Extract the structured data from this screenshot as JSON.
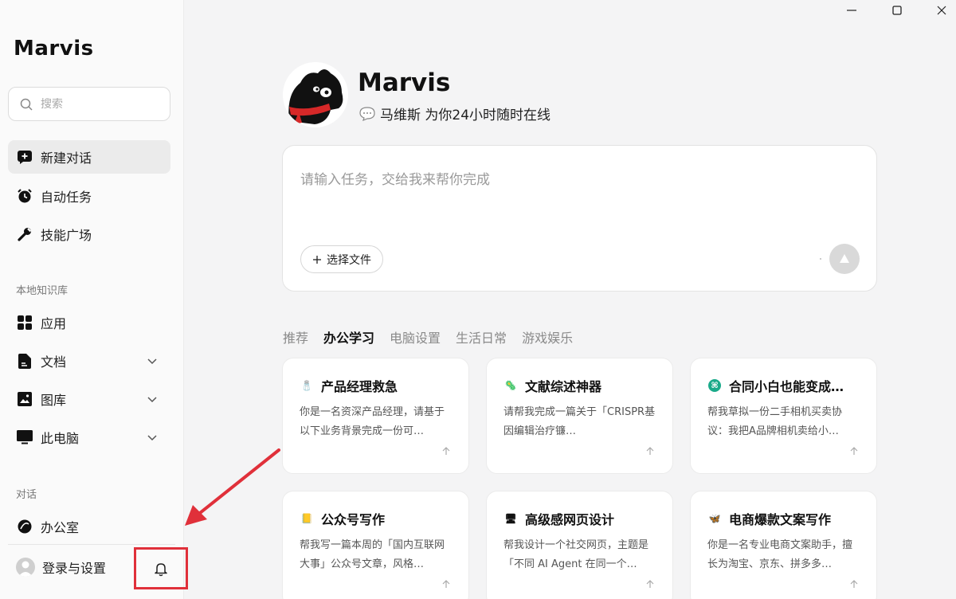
{
  "app": {
    "brand": "Marvis"
  },
  "colors": {
    "accent_red": "#e0303a",
    "background": "#f4f4f5"
  },
  "sidebar": {
    "search_placeholder": "搜索",
    "nav": [
      {
        "label": "新建对话",
        "icon": "new-chat-icon",
        "active": true
      },
      {
        "label": "自动任务",
        "icon": "alarm-clock-icon"
      },
      {
        "label": "技能广场",
        "icon": "wrench-icon"
      }
    ],
    "knowledge_label": "本地知识库",
    "knowledge": [
      {
        "label": "应用",
        "icon": "apps-grid-icon"
      },
      {
        "label": "文档",
        "icon": "document-icon"
      },
      {
        "label": "图库",
        "icon": "image-icon"
      },
      {
        "label": "此电脑",
        "icon": "monitor-icon"
      }
    ],
    "chat_label": "对话",
    "chats": [
      {
        "label": "办公室",
        "icon": "office-icon"
      }
    ],
    "login_label": "登录与设置"
  },
  "main": {
    "agent_name": "Marvis",
    "agent_tagline": "马维斯 为你24小时随时在线",
    "composer_placeholder": "请输入任务，交给我来帮你完成",
    "file_button": "选择文件",
    "tabs": [
      "推荐",
      "办公学习",
      "电脑设置",
      "生活日常",
      "游戏娱乐"
    ],
    "active_tab": "办公学习",
    "cards": [
      {
        "title": "产品经理救急",
        "emoji": "🧂",
        "desc": "你是一名资深产品经理，请基于以下业务背景完成一份可…"
      },
      {
        "title": "文献综述神器",
        "emoji": "🦠",
        "desc": "请帮我完成一篇关于「CRISPR基因编辑治疗镰…"
      },
      {
        "title": "合同小白也能变成…",
        "emoji": "⌘",
        "desc": "帮我草拟一份二手相机买卖协议：我把A品牌相机卖给小…"
      },
      {
        "title": "公众号写作",
        "emoji": "📒",
        "desc": "帮我写一篇本周的「国内互联网大事」公众号文章，风格…"
      },
      {
        "title": "高级感网页设计",
        "emoji": "🖥",
        "desc": "帮我设计一个社交网页，主题是「不同 AI Agent 在同一个…"
      },
      {
        "title": "电商爆款文案写作",
        "emoji": "🦋",
        "desc": "你是一名专业电商文案助手，擅长为淘宝、京东、拼多多…"
      }
    ]
  }
}
